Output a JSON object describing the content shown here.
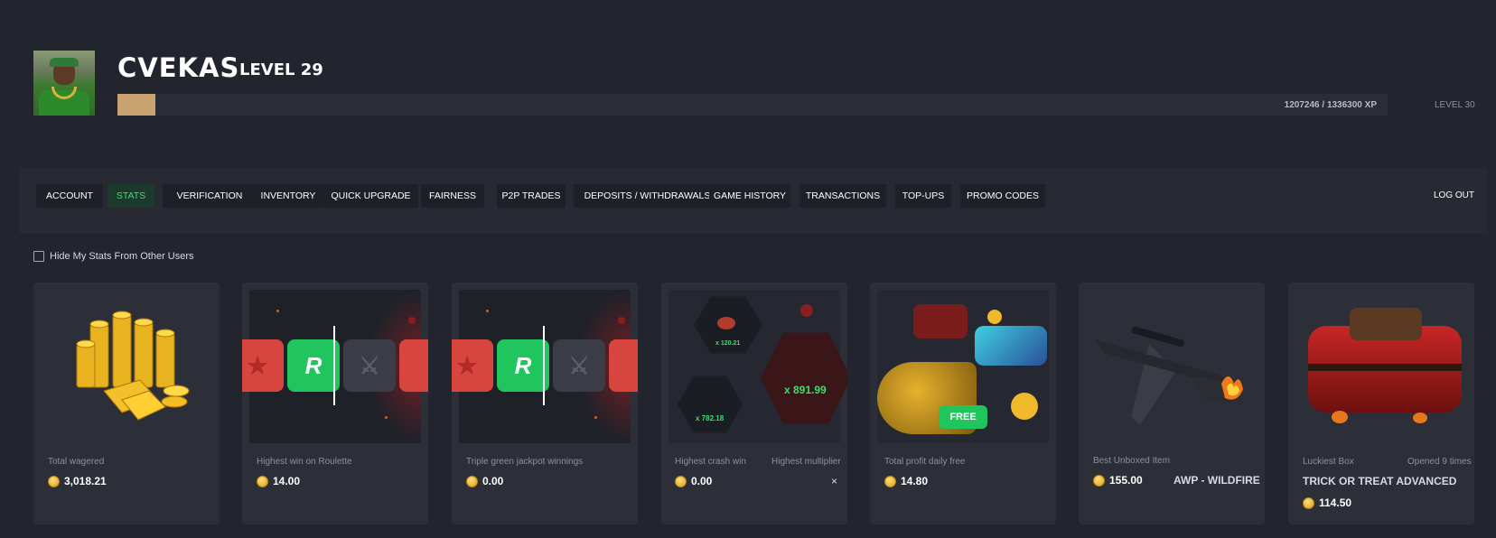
{
  "profile": {
    "username": "CVEKAS",
    "level_label": "LEVEL 29",
    "xp_text": "1207246 / 1336300 XP",
    "xp_progress": 0.03,
    "next_level_label": "LEVEL 30"
  },
  "tabs": [
    {
      "label": "ACCOUNT",
      "active": false
    },
    {
      "label": "STATS",
      "active": true
    },
    {
      "label": "VERIFICATION",
      "active": false
    },
    {
      "label": "INVENTORY",
      "active": false
    },
    {
      "label": "QUICK UPGRADE",
      "active": false
    },
    {
      "label": "FAIRNESS",
      "active": false
    },
    {
      "label": "P2P TRADES",
      "active": false
    },
    {
      "label": "DEPOSITS / WITHDRAWALS",
      "active": false
    },
    {
      "label": "GAME HISTORY",
      "active": false
    },
    {
      "label": "TRANSACTIONS",
      "active": false
    },
    {
      "label": "TOP-UPS",
      "active": false
    },
    {
      "label": "PROMO CODES",
      "active": false
    }
  ],
  "logout_label": "LOG OUT",
  "hide_stats": {
    "label": "Hide My Stats From Other Users",
    "checked": false
  },
  "cards": {
    "total_wagered": {
      "label": "Total wagered",
      "value": "3,018.21"
    },
    "roulette": {
      "label": "Highest win on Roulette",
      "value": "14.00"
    },
    "jackpot": {
      "label": "Triple green jackpot winnings",
      "value": "0.00"
    },
    "crash": {
      "label": "Highest crash win",
      "label2": "Highest multiplier",
      "value": "0.00",
      "value2": "×",
      "multipliers": [
        "x 120.21",
        "x 891.99",
        "x 782.18"
      ]
    },
    "daily_free": {
      "label": "Total profit daily free",
      "value": "14.80",
      "badge": "FREE"
    },
    "best_unboxed": {
      "label": "Best Unboxed Item",
      "value": "155.00",
      "item_name": "AWP - WILDFIRE"
    },
    "luckiest_box": {
      "label": "Luckiest Box",
      "opened": "Opened 9 times",
      "name": "TRICK OR TREAT ADVANCED",
      "value": "114.50"
    }
  },
  "colors": {
    "background": "#22252d",
    "card": "#2c2f38",
    "accent_green": "#3fdc6b",
    "xp_fill": "#c9a272",
    "coin": "#f0b92a"
  },
  "icons": [
    "coin-icon",
    "roulette-r-icon",
    "ct-icon",
    "t-icon",
    "checkbox-icon"
  ]
}
